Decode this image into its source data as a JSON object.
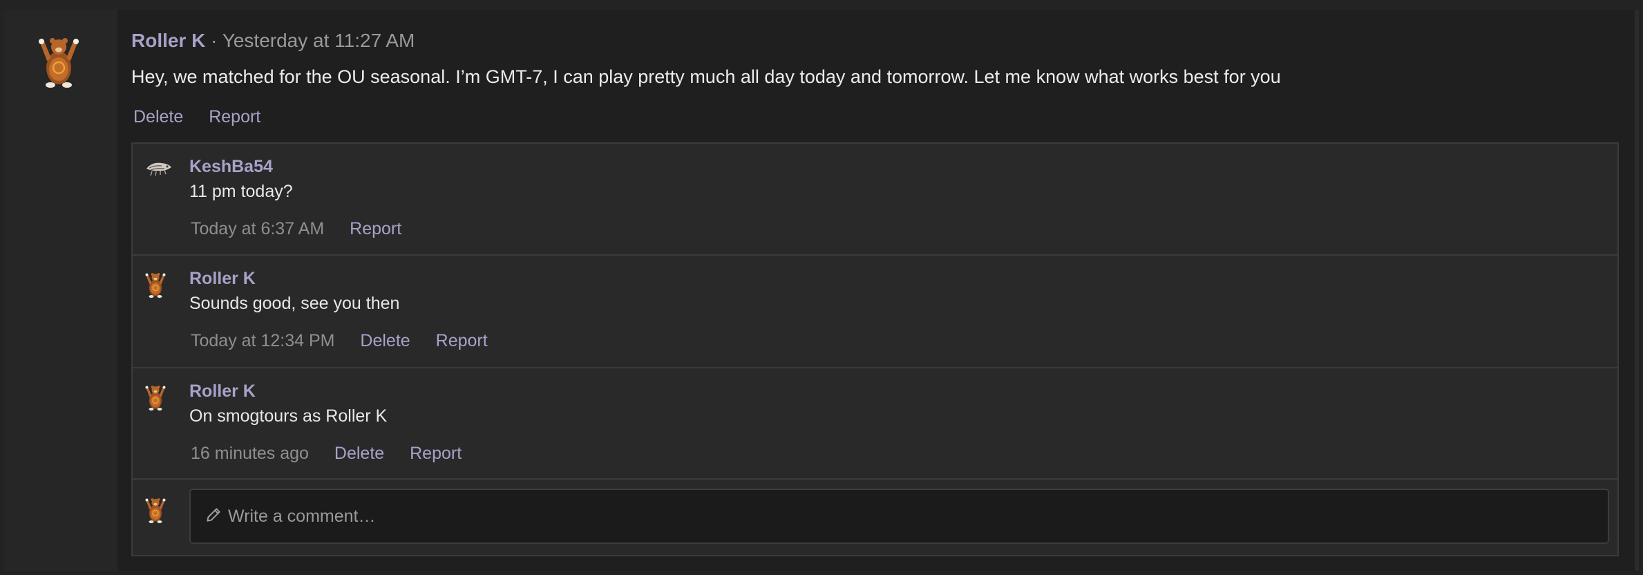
{
  "post": {
    "author": "Roller K",
    "separator": "·",
    "timestamp": "Yesterday at 11:27 AM",
    "body": "Hey, we matched for the OU seasonal. I’m GMT-7, I can play pretty much all day today and tomorrow. Let me know what works best for you",
    "actions": {
      "delete": "Delete",
      "report": "Report"
    },
    "avatar_icon": "bear-avatar-icon"
  },
  "comments": [
    {
      "author": "KeshBa54",
      "text": "11 pm today?",
      "time": "Today at 6:37 AM",
      "actions": [
        "Report"
      ],
      "avatar_icon": "fossil-avatar-icon"
    },
    {
      "author": "Roller K",
      "text": "Sounds good, see you then",
      "time": "Today at 12:34 PM",
      "actions": [
        "Delete",
        "Report"
      ],
      "avatar_icon": "bear-avatar-icon"
    },
    {
      "author": "Roller K",
      "text": "On smogtours as Roller K",
      "time": "16 minutes ago",
      "actions": [
        "Delete",
        "Report"
      ],
      "avatar_icon": "bear-avatar-icon"
    }
  ],
  "composer": {
    "placeholder": "Write a comment…",
    "icon": "pencil-icon",
    "avatar_icon": "bear-avatar-icon"
  },
  "colors": {
    "username": "#a8a2c9",
    "page_background": "#1f1f1f",
    "comment_background": "#292929",
    "bear_fur": "#b8652a",
    "bear_ring": "#f0a030"
  }
}
